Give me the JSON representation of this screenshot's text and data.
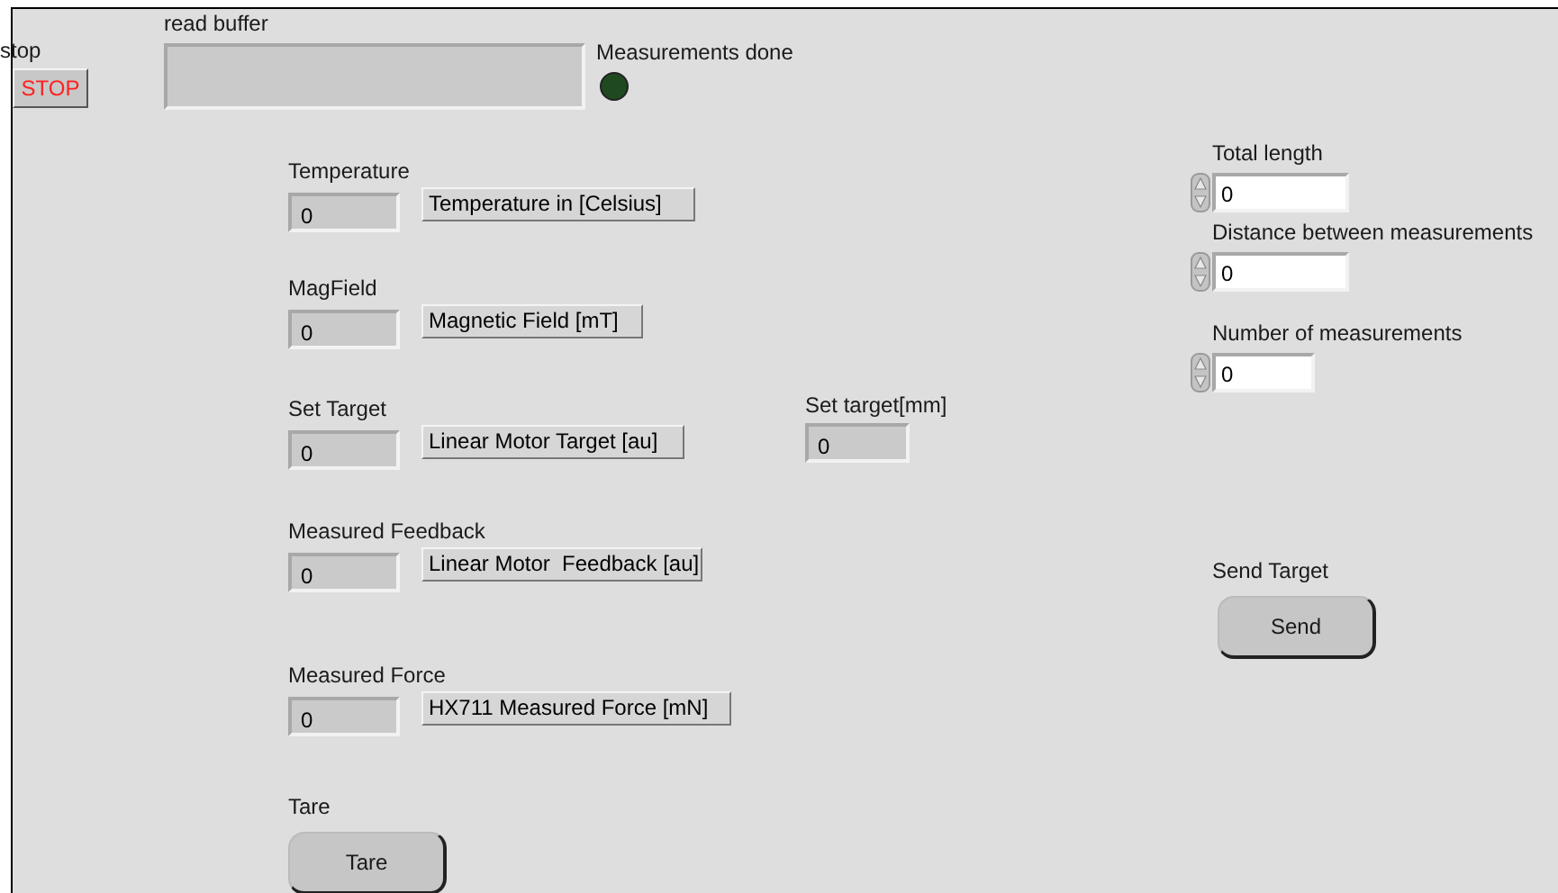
{
  "stop": {
    "label": "stop",
    "button": "STOP"
  },
  "read_buffer": {
    "label": "read buffer"
  },
  "measurements_done": {
    "label": "Measurements done",
    "on": false
  },
  "indicators": [
    {
      "label": "Temperature",
      "value": "0",
      "caption": "Temperature in [Celsius]"
    },
    {
      "label": "MagField",
      "value": "0",
      "caption": "Magnetic Field [mT]"
    },
    {
      "label": "Set Target",
      "value": "0",
      "caption": "Linear Motor Target [au]"
    },
    {
      "label": "Measured Feedback",
      "value": "0",
      "caption": "Linear Motor  Feedback [au]"
    },
    {
      "label": "Measured Force",
      "value": "0",
      "caption": "HX711 Measured Force [mN]"
    }
  ],
  "set_target_mm": {
    "label": "Set target[mm]",
    "value": "0"
  },
  "controls": [
    {
      "label": "Total length",
      "value": "0"
    },
    {
      "label": "Distance between measurements",
      "value": "0"
    },
    {
      "label": "Number of measurements",
      "value": "0"
    }
  ],
  "send": {
    "label": "Send Target",
    "button": "Send"
  },
  "tare": {
    "label": "Tare",
    "button": "Tare"
  }
}
